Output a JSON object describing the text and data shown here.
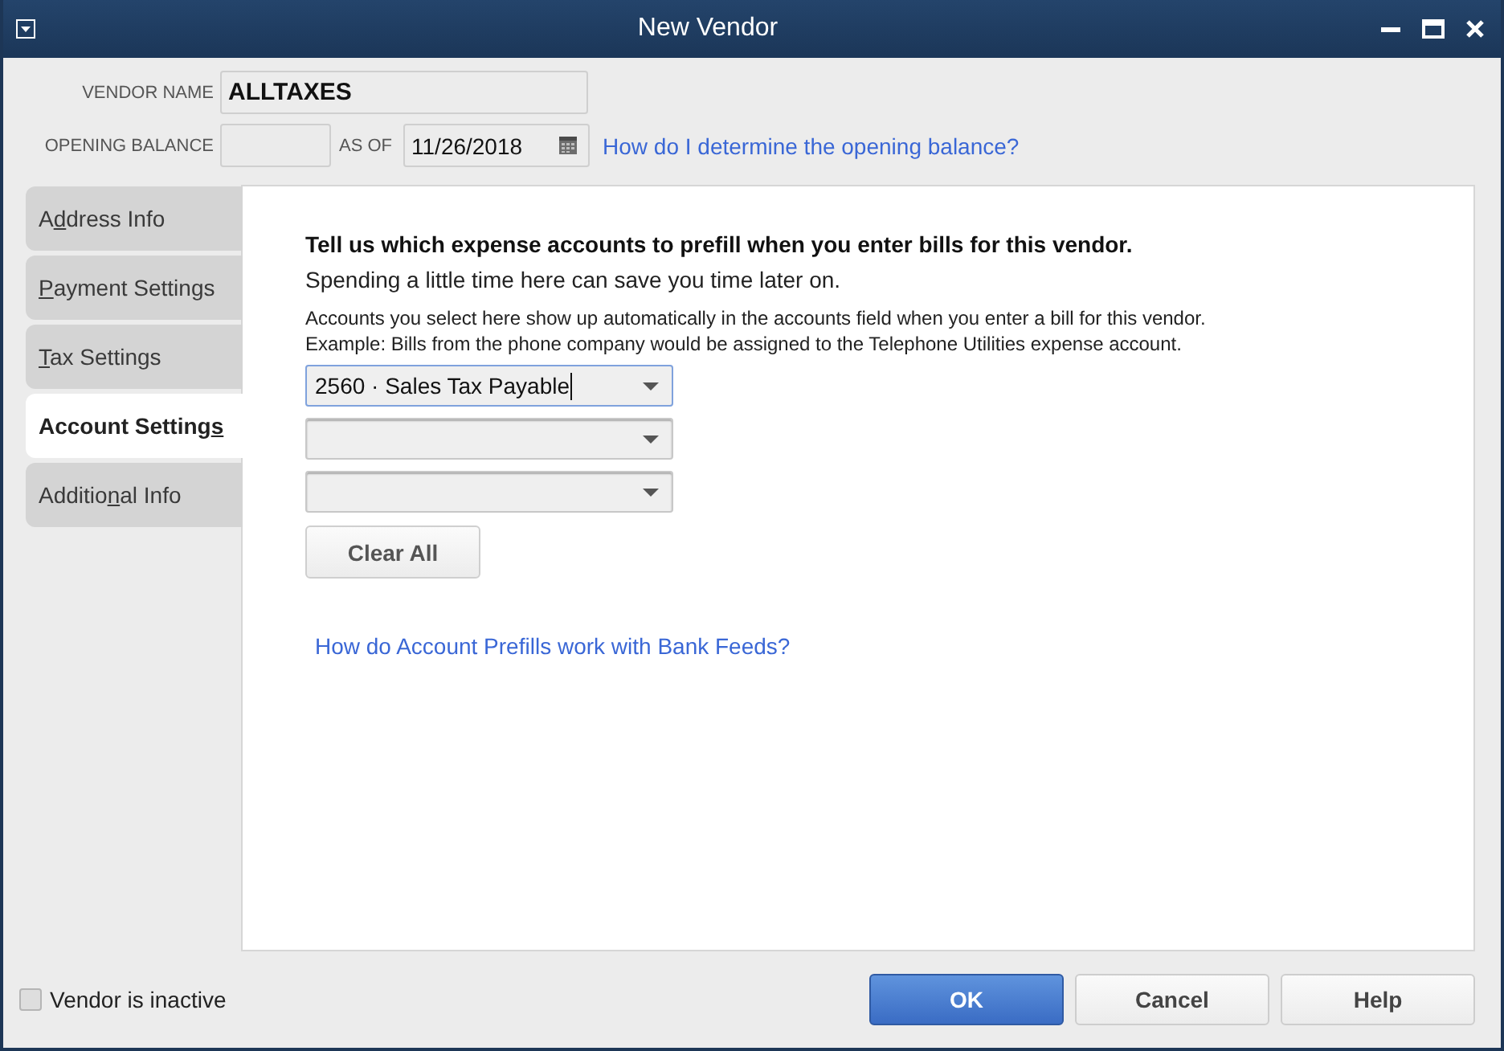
{
  "window": {
    "title": "New Vendor"
  },
  "header": {
    "vendor_name": {
      "label": "VENDOR NAME",
      "value": "ALLTAXES"
    },
    "opening_balance": {
      "label": "OPENING BALANCE"
    },
    "as_of": {
      "label": "AS OF",
      "value": "11/26/2018"
    },
    "help_link": "How do I determine the opening balance?"
  },
  "tabs": [
    {
      "label": {
        "before": "A",
        "underlined": "d",
        "after": "dress Info"
      },
      "selected": false
    },
    {
      "label": {
        "underlined": "P",
        "after": "ayment Settings"
      },
      "selected": false
    },
    {
      "label": {
        "underlined": "T",
        "after": "ax Settings"
      },
      "selected": false
    },
    {
      "label": {
        "before": "Account Setting",
        "underlined": "s"
      },
      "selected": true
    },
    {
      "label": {
        "before": "Additio",
        "underlined": "n",
        "after": "al Info"
      },
      "selected": false
    }
  ],
  "account_settings": {
    "heading": "Tell us which expense accounts to prefill when you enter bills for this vendor.",
    "subheading": "Spending a little time here can save you time later on.",
    "description": [
      "Accounts you select here show up automatically in the accounts field when you enter a bill for this vendor.",
      "Example: Bills from the phone company would be assigned to the Telephone Utilities expense account."
    ],
    "account_fields": [
      {
        "value": "2560 · Sales Tax Payable",
        "focused": true
      },
      {
        "focused": false
      },
      {
        "focused": false
      }
    ],
    "clear_button": "Clear All",
    "link": "How do Account Prefills work with Bank Feeds?"
  },
  "footer": {
    "inactive_checkbox": {
      "label": "Vendor is inactive",
      "checked": false
    },
    "buttons": [
      {
        "label": "OK",
        "kind": "primary"
      },
      {
        "label": "Cancel",
        "kind": "default"
      },
      {
        "label": "Help",
        "kind": "default"
      }
    ]
  }
}
